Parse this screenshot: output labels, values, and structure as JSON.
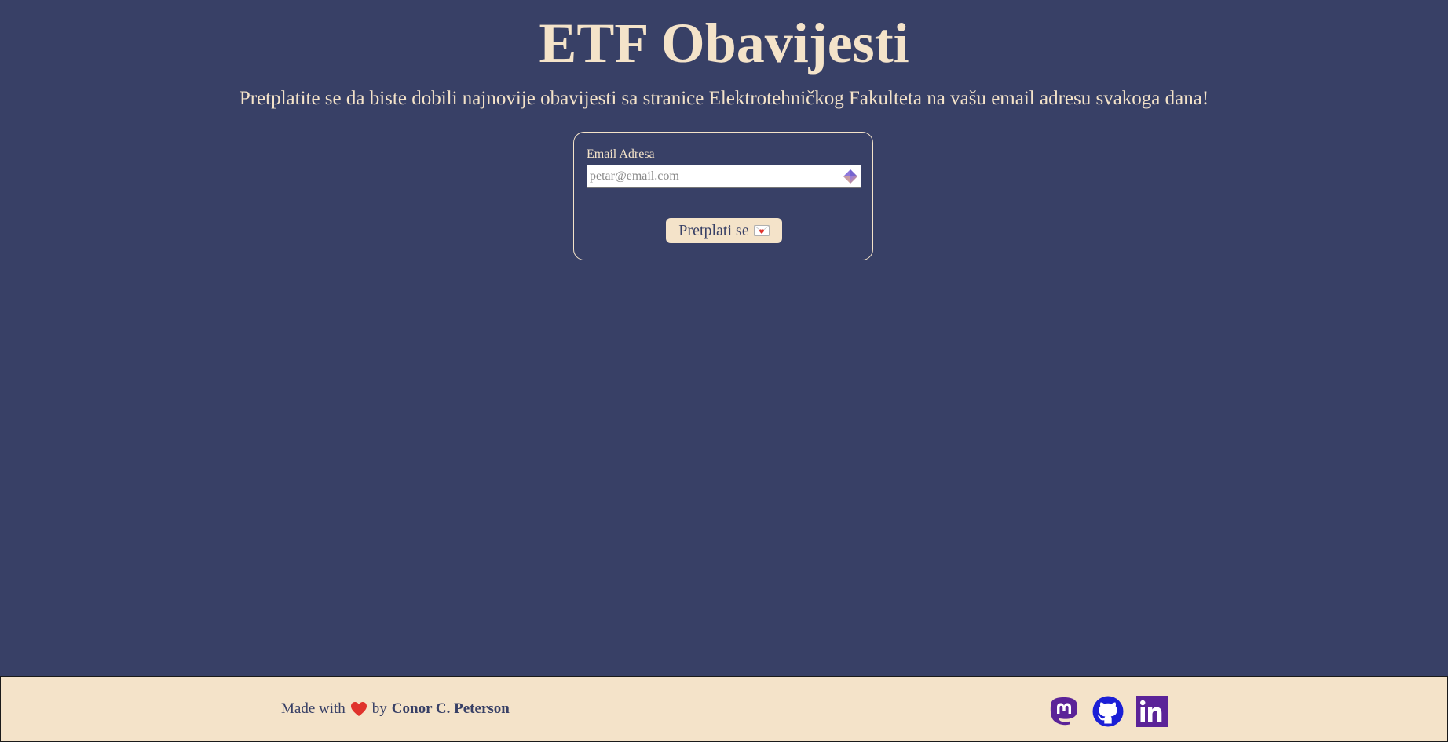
{
  "header": {
    "title": "ETF Obavijesti",
    "subtitle": "Pretplatite se da biste dobili najnovije obavijesti sa stranice Elektrotehničkog Fakulteta na vašu email adresu svakoga dana!"
  },
  "form": {
    "email_label": "Email Adresa",
    "email_placeholder": "petar@email.com",
    "email_value": "",
    "submit_label": "Pretplati se",
    "autofill_icon": "autofill-extension-icon",
    "submit_icon": "envelope-heart-icon"
  },
  "footer": {
    "made_with": "Made with",
    "heart_icon": "heart-icon",
    "by": "by",
    "author": "Conor C. Peterson",
    "social_links": [
      {
        "name": "mastodon",
        "icon": "mastodon-icon"
      },
      {
        "name": "github",
        "icon": "github-icon"
      },
      {
        "name": "linkedin",
        "icon": "linkedin-icon"
      }
    ]
  },
  "colors": {
    "background": "#384066",
    "accent": "#f4e3c9",
    "social_purple": "#5b2398",
    "github_blue": "#1b1fd6",
    "heart_red": "#e0332d"
  }
}
